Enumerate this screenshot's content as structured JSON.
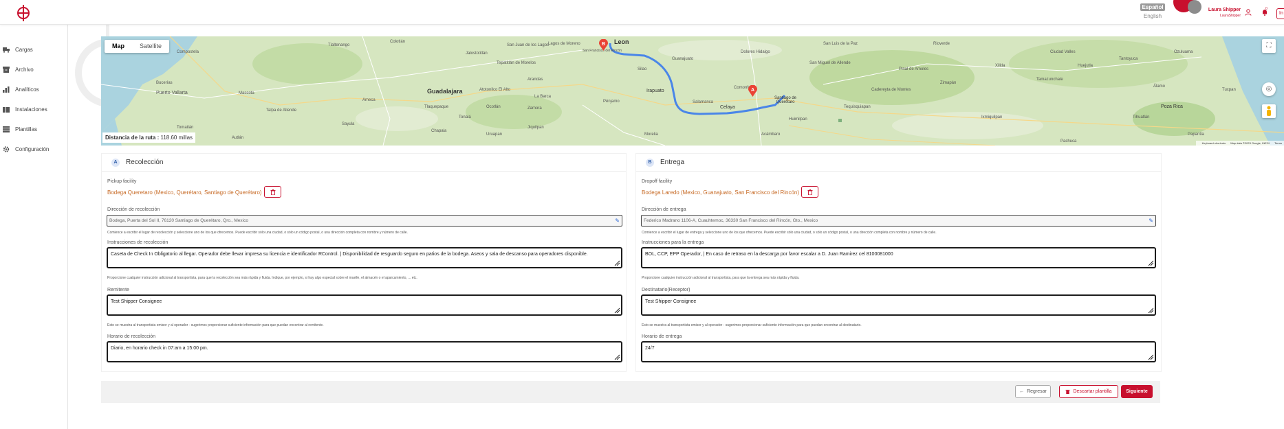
{
  "header": {
    "lang_active": "Español",
    "lang_other": "English",
    "user_name": "Laura Shipper",
    "user_handle": "LauraShipper",
    "notif_count": "0",
    "logout_label": "In"
  },
  "sidebar": {
    "items": [
      {
        "label": "Cargas",
        "icon": "truck-icon"
      },
      {
        "label": "Archivo",
        "icon": "archive-icon"
      },
      {
        "label": "Analíticos",
        "icon": "bar-chart-icon"
      },
      {
        "label": "Instalaciones",
        "icon": "building-icon"
      },
      {
        "label": "Plantillas",
        "icon": "template-icon"
      },
      {
        "label": "Configuración",
        "icon": "gear-icon"
      }
    ]
  },
  "map": {
    "tab_map": "Map",
    "tab_satellite": "Satellite",
    "distance_label": "Distancia de la ruta :",
    "distance_value": "118.60 millas",
    "footer_shortcuts": "Keyboard shortcuts",
    "footer_data": "Map data ©2023 Google, INEGI",
    "footer_terms": "Terms",
    "marker_a": "A",
    "marker_b": "B",
    "cities": {
      "leon": "Leon",
      "guadalajara": "Guadalajara",
      "irapuato": "Irapuato",
      "celaya": "Celaya",
      "queretaro": "Santiago de Querétaro",
      "salamanca": "Salamanca",
      "puerto_vallarta": "Puerto Vallarta",
      "poza_rica": "Poza Rica",
      "san_francisco": "San Francisco del Rincón",
      "tepatitlan": "Tepatitlán de Morelos",
      "zacatecas_road": "San Miguel de Allende",
      "pachuca": "Pachuca",
      "tequisquiapan": "Tequisquiapan",
      "zamora": "Zamora",
      "uruapan": "Uruapan",
      "morelia": "Morelia",
      "autlan": "Autlán",
      "dolores": "Dolores Hidalgo",
      "rio_verde": "Rioverde",
      "san_luis": "San Luis de la Paz",
      "ciudad_valles": "Ciudad Valles",
      "tampico": "Tamazunchale",
      "tuxpan": "Tuxpan",
      "ixmiquilpan": "Ixmiquilpan",
      "lagos": "Lagos de Moreno",
      "aguascalientes": "San Juan de los Lagos",
      "ameca": "Ameca",
      "ocotlan": "Ocotlán",
      "la_barca": "La Barca",
      "sayula": "Sayula",
      "pv_bay": "Bucerías",
      "compostela": "Compostela",
      "tlaquepaque": "Tlaquepaque",
      "penjamo": "Pénjamo",
      "acambaro": "Acámbaro",
      "jiquilpan": "Jiquilpan",
      "silao": "Silao",
      "guanajuato": "Guanajuato",
      "comonfort": "Comonfort",
      "huimilpan": "Huimilpan",
      "cadereyta": "Cadereyta de Montes",
      "zimapan": "Zimapán",
      "pinal": "Pinal de Amoles",
      "xilitla": "Xilitla",
      "huejutla": "Huejutla",
      "tantoyuca": "Tantoyuca",
      "ozuluama": "Ozuluama",
      "papantla": "Papantla",
      "tihuatlan": "Tihuatlán",
      "alamo": "Álamo",
      "tlaltenango": "Tlaltenango",
      "colotlan": "Colotlán",
      "jalostotitlan": "Jalostotitlán",
      "arandas": "Arandas",
      "atotonilco": "Atotonilco El Alto",
      "tonala": "Tonalá",
      "chapala": "Chapala",
      "mascota": "Mascota",
      "talpa": "Talpa de Allende",
      "tomatlan": "Tomatlán"
    }
  },
  "pickup": {
    "badge": "A",
    "title": "Recolección",
    "facility_label": "Pickup facility",
    "facility_value": "Bodega Queretaro (Mexico, Querétaro, Santiago de Querétaro)",
    "address_label": "Dirección de recolección",
    "address_value": "Bodega, Puerta del Sol II, 76120 Santiago de Querétaro, Qro., Mexico",
    "address_hint": "Comience a escribir el lugar de recolección y seleccione uno de los que ofrecemos. Puede escribir sólo una ciudad, o sólo un código postal, o una dirección completa con nombre y número de calle.",
    "instructions_label": "Instrucciones de recolección",
    "instructions_value": "Caseta de Check In Obligatorio al llegar. Operador debe llevar impresa su licencia e identificador RControl. | Disponibilidad de resguardo seguro en patios de la bodega. Aseos y sala de descanso para operadores disponible.",
    "instructions_hint": "Proporcione cualquier instrucción adicional al transportista, para que la recolección sea más rápida y fluida. Indique, por ejemplo, si hay algo especial sobre el muelle, el almacén o el aparcamiento, ... etc.",
    "sender_label": "Remitente",
    "sender_value": "Test Shipper Consignee",
    "sender_hint": "Esto se muestra al transportista emisor y al operador - sugerimos proporcionar suficiente información para que puedan encontrar al remitente.",
    "hours_label": "Horario de recolección",
    "hours_value": "Diario, en horario check in 07:am a 15:00 pm."
  },
  "dropoff": {
    "badge": "B",
    "title": "Entrega",
    "facility_label": "Dropoff facility",
    "facility_value": "Bodega Laredo (Mexico, Guanajuato, San Francisco del Rincón)",
    "address_label": "Dirección de entrega",
    "address_value": "Federico Madrano 1106-A, Cuauhtemoc, 36330 San Francisco del Rincón, Gto., Mexico",
    "address_hint": "Comience a escribir el lugar de entrega y seleccione uno de los que ofrecemos. Puede escribir sólo una ciudad, o sólo un código postal, o una dirección completa con nombre y número de calle.",
    "instructions_label": "Instrucciones para la entrega",
    "instructions_value": "BOL, CCP, EPP Operador, | En caso de retraso en la descarga por favor escalar a D. Juan Ramirez cel 8100081000",
    "instructions_hint": "Proporcione cualquier instrucción adicional al transportista, para que la entrega sea más rápida y fluida.",
    "recipient_label": "Destinatario(Receptor)",
    "recipient_value": "Test Shipper Consignee",
    "recipient_hint": "Esto se muestra al transportista emisor y al operador - sugerimos proporcionar suficiente información para que puedan encontrar al destinatario.",
    "hours_label": "Horario de entrega",
    "hours_value": "24/7"
  },
  "footer": {
    "back_label": "Regresar",
    "discard_label": "Descartar plantilla",
    "next_label": "Siguiente"
  },
  "colors": {
    "brand_red": "#c8102e",
    "facility_orange": "#c76a25",
    "route_blue": "#4a86e8"
  }
}
